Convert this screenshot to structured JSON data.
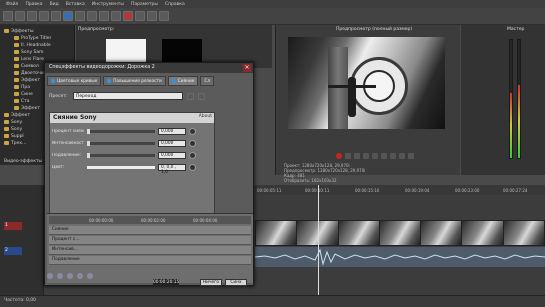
{
  "menubar": {
    "items": [
      "Файл",
      "Правка",
      "Вид",
      "Вставка",
      "Инструменты",
      "Параметры",
      "Справка"
    ]
  },
  "media": {
    "label": "Предпросмотр:",
    "tree": [
      "Эффекты",
      "ProType Titler",
      "Il. Headnable",
      "Sony Sam",
      "Lens Flare",
      "Символ",
      "Двоеточия",
      "Эффект",
      "Пра",
      "Сине",
      "Ста",
      "Эффект",
      "Эффект",
      "Sony",
      "Sony",
      "Suppl",
      "Трех...",
      "Видео-эффекты"
    ]
  },
  "preview": {
    "title": "Предпросмотр (полный размер)",
    "info": [
      "Проект:   1280x720x128, 29,970i",
      "Предпросмотр:  1280x720x128, 29,970i",
      "Кадр:  481",
      "Отобразить:  182x103x32"
    ]
  },
  "meters": {
    "label": "Мастер",
    "levels": [
      0.55,
      0.62
    ]
  },
  "dialog": {
    "title": "Спецэффекты видеодорожки: Дорожка 2",
    "close": "×",
    "tabs": [
      "Цветовые кривые",
      "Повышение резкости",
      "Сияние",
      "Сл"
    ],
    "preset_label": "Пресет:",
    "preset_value": "Переход",
    "plugin_name": "Сияние Sony",
    "about": "About",
    "params": [
      {
        "label": "Процент сияния:",
        "value": "0,000",
        "level": 0.0
      },
      {
        "label": "Интенсивность:",
        "value": "0,000",
        "level": 0.0
      },
      {
        "label": "Подавление:",
        "value": "0,000",
        "level": 0.0
      },
      {
        "label": "Цвет:",
        "value": "0, 0,0 , 1,0",
        "level": 0.0
      }
    ],
    "keyframes": {
      "ruler": [
        "00:00:00:00",
        "00:00:02:00",
        "00:00:04:00"
      ],
      "rows": [
        "Сияние",
        "Процент с...",
        "Интенсив...",
        "Подавление"
      ]
    },
    "timecode": "00:00:20:15",
    "buttons": [
      "Ничего",
      "Синх"
    ]
  },
  "timeline": {
    "ruler": [
      "00:00:05:11",
      "00:00:10:11",
      "00:00:15:16",
      "00:00:19:04",
      "00:00:23:00",
      "00:00:27:24"
    ],
    "tracks": [
      "1",
      "2"
    ]
  },
  "status": {
    "text": "Частота: 0,00"
  }
}
